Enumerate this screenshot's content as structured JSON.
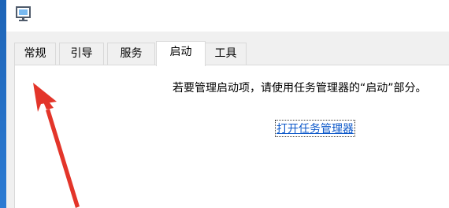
{
  "tabs": [
    {
      "label": "常规"
    },
    {
      "label": "引导"
    },
    {
      "label": "服务"
    },
    {
      "label": "启动"
    },
    {
      "label": "工具"
    }
  ],
  "active_tab": "启动",
  "startup": {
    "info_text": "若要管理启动项，请使用任务管理器的“启动”部分。",
    "link_text": "打开任务管理器"
  },
  "icons": {
    "app": "system-configuration-icon",
    "annotation": "red-arrow-annotation"
  },
  "colors": {
    "link": "#0b57c9",
    "arrow": "#e3352a",
    "window_bg": "#f0f0f0",
    "panel_bg": "#ffffff"
  }
}
